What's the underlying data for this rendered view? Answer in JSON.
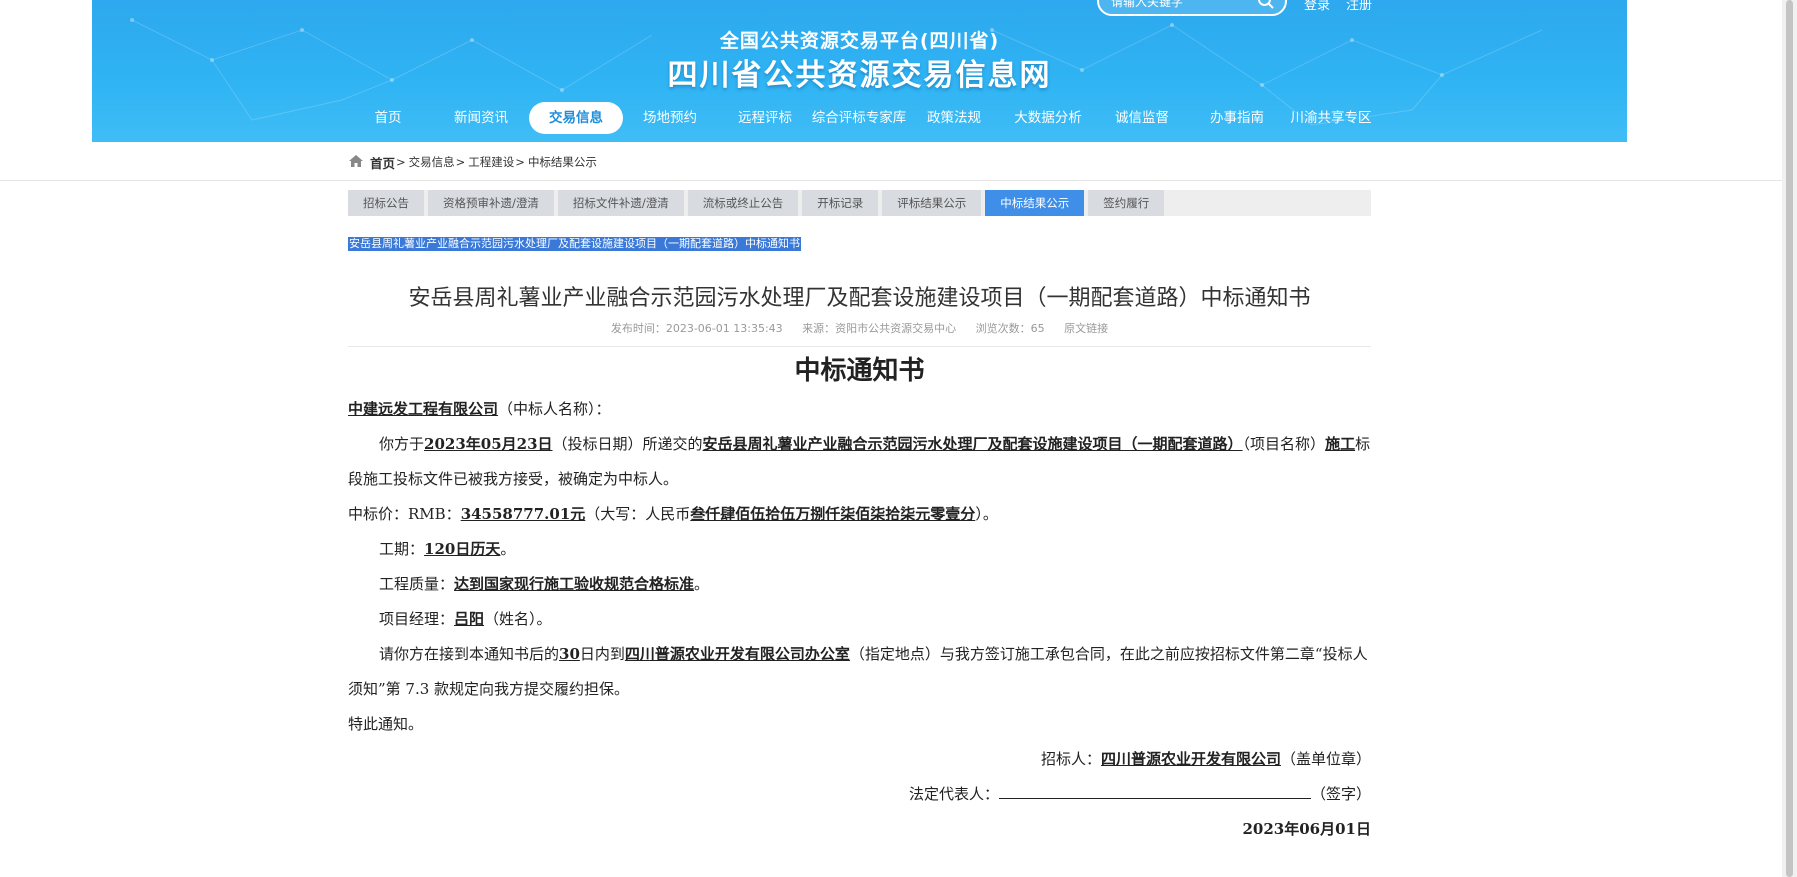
{
  "header": {
    "subtitle": "全国公共资源交易平台(四川省)",
    "title": "四川省公共资源交易信息网",
    "search_placeholder": "请输入关键字",
    "login": "登录",
    "register": "注册"
  },
  "nav": [
    {
      "label": "首页"
    },
    {
      "label": "新闻资讯"
    },
    {
      "label": "交易信息",
      "active": true
    },
    {
      "label": "场地预约"
    },
    {
      "label": "远程评标"
    },
    {
      "label": "综合评标专家库"
    },
    {
      "label": "政策法规"
    },
    {
      "label": "大数据分析"
    },
    {
      "label": "诚信监督"
    },
    {
      "label": "办事指南"
    },
    {
      "label": "川渝共享专区"
    }
  ],
  "breadcrumb": {
    "home": "首页",
    "items": [
      "交易信息",
      "工程建设",
      "中标结果公示"
    ]
  },
  "tabs": [
    {
      "label": "招标公告"
    },
    {
      "label": "资格预审补遗/澄清"
    },
    {
      "label": "招标文件补遗/澄清"
    },
    {
      "label": "流标或终止公告"
    },
    {
      "label": "开标记录"
    },
    {
      "label": "评标结果公示"
    },
    {
      "label": "中标结果公示",
      "active": true
    },
    {
      "label": "签约履行"
    }
  ],
  "selected_title": "安岳县周礼薯业产业融合示范园污水处理厂及配套设施建设项目（一期配套道路）中标通知书",
  "notice": {
    "title": "安岳县周礼薯业产业融合示范园污水处理厂及配套设施建设项目（一期配套道路）中标通知书",
    "publish_time": "发布时间：2023-06-01 13:35:43",
    "source": "来源：资阳市公共资源交易中心",
    "views": "浏览次数：65",
    "original_link": "原文链接"
  },
  "document": {
    "heading": "中标通知书",
    "winner": "中建远发工程有限公司",
    "winner_suffix": "（中标人名称）：",
    "p1_a": "你方于",
    "bid_date": "2023年05月23日",
    "p1_b": "（投标日期）所递交的",
    "project_name": "安岳县周礼薯业产业融合示范园污水处理厂及配套设施建设项目（一期配套道路）",
    "p1_c": "（项目名称）",
    "section": "施工",
    "p1_d": "标段施工投标文件已被我方接受，被确定为中标人。",
    "price_label": "中标价：RMB：",
    "price": "34558777.01元",
    "price_mid": "（大写：人民币",
    "price_words": "叁仟肆佰伍拾伍万捌仟柒佰柒拾柒元零壹分",
    "price_end": "）。",
    "period_label": "工期：",
    "period": "120日历天",
    "period_end": "。",
    "quality_label": "工程质量：",
    "quality": "达到国家现行施工验收规范合格标准",
    "quality_end": "。",
    "manager_label": "项目经理：",
    "manager": "吕阳",
    "manager_end": "（姓名）。",
    "p5_a": "请你方在接到本通知书后的",
    "days": "30",
    "p5_b": "日内到",
    "place": "四川普源农业开发有限公司办公室",
    "p5_c": "（指定地点）与我方签订施工承包合同，在此之前应按招标文件第二章“投标人须知”第 7.3 款规定向我方提交履约担保。",
    "closing": "特此通知。",
    "tenderer_label": "招标人：",
    "tenderer": "四川普源农业开发有限公司",
    "tenderer_end": "（盖单位章）",
    "rep_label": "法定代表人：",
    "rep_end": "（签字）",
    "date": "2023年06月01日"
  },
  "colors": {
    "header_blue": "#2fb3f3",
    "active_tab": "#3f8ee8",
    "selection": "#3a79d8"
  }
}
